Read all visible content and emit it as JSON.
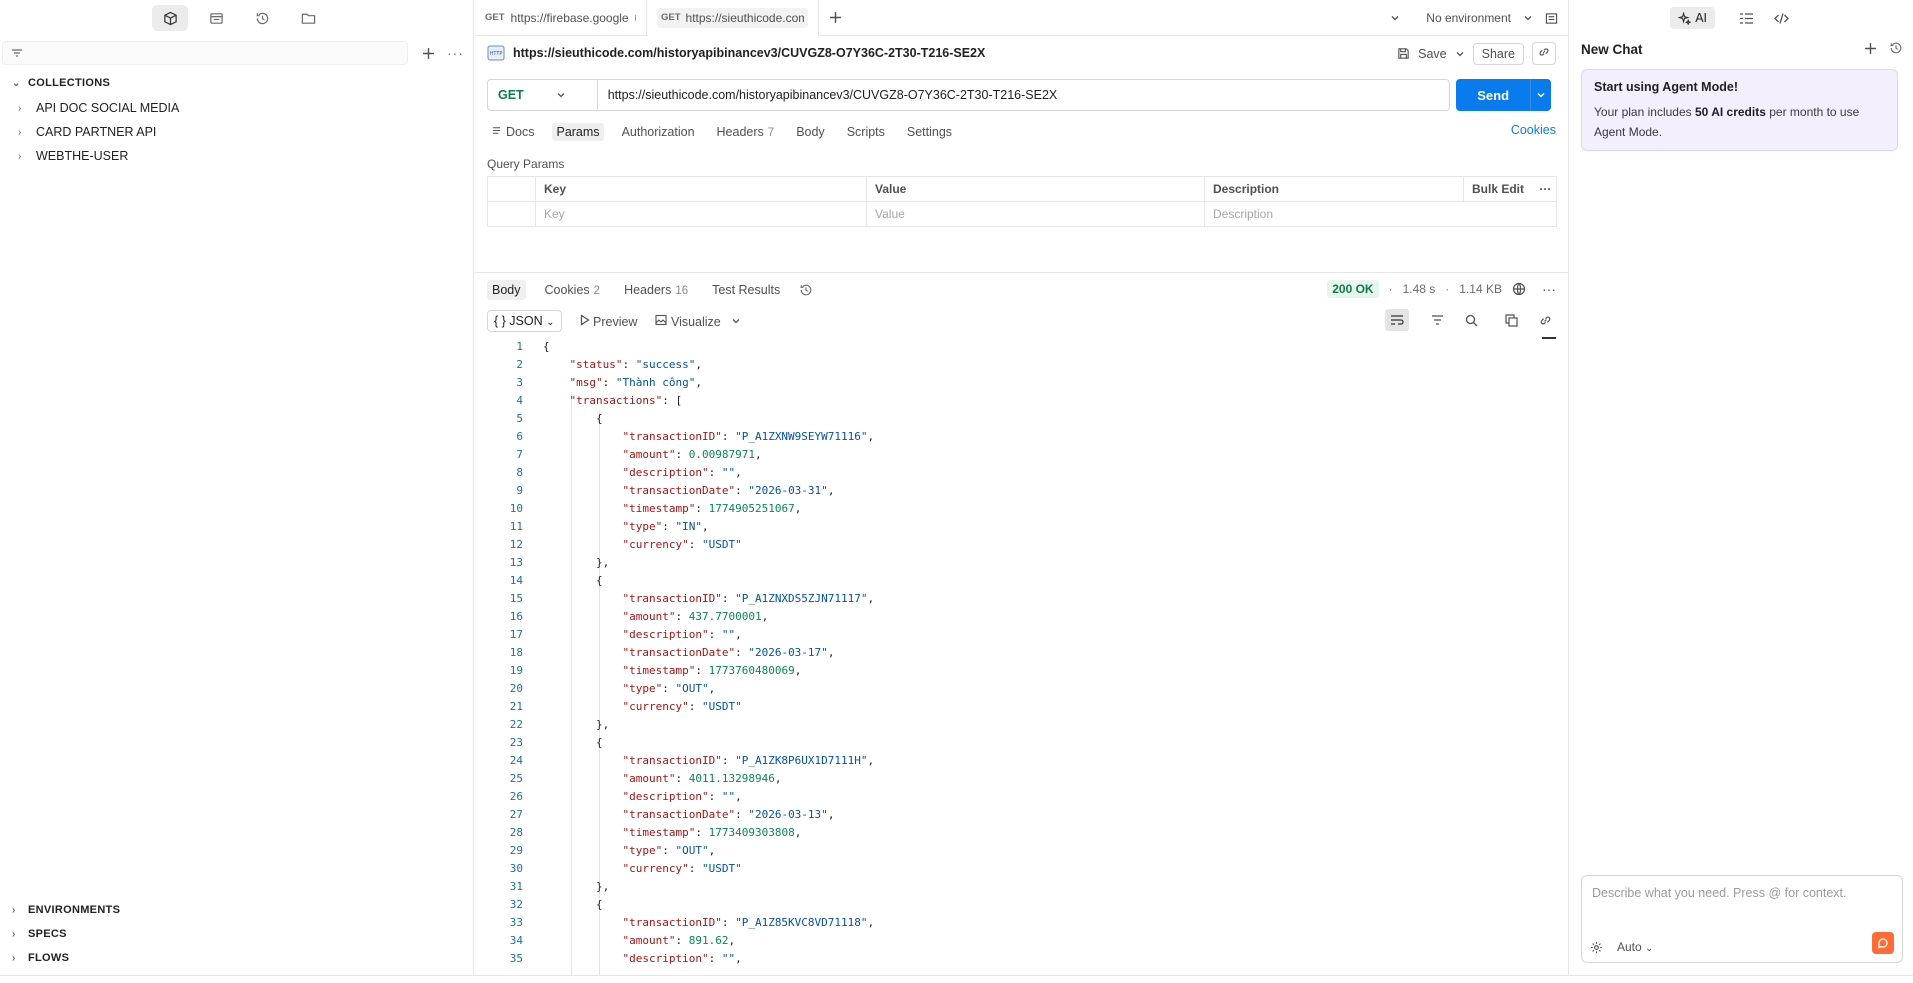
{
  "sidebar": {
    "filter_placeholder": "",
    "collections_title": "COLLECTIONS",
    "collections": [
      {
        "label": "API DOC SOCIAL MEDIA"
      },
      {
        "label": "CARD PARTNER API"
      },
      {
        "label": "WEBTHE-USER"
      }
    ],
    "environments_title": "ENVIRONMENTS",
    "specs_title": "SPECS",
    "flows_title": "FLOWS"
  },
  "tabs": [
    {
      "method": "GET",
      "label": "https://firebase.google"
    },
    {
      "method": "GET",
      "label": "https://sieuthicode.com"
    }
  ],
  "environment": {
    "selected": "No environment"
  },
  "request": {
    "title_url": "https://sieuthicode.com/historyapibinancev3/CUVGZ8-O7Y36C-2T30-T216-SE2X",
    "save_label": "Save",
    "share_label": "Share",
    "method": "GET",
    "url": "https://sieuthicode.com/historyapibinancev3/CUVGZ8-O7Y36C-2T30-T216-SE2X",
    "send_label": "Send",
    "tabs": [
      {
        "label": "Docs"
      },
      {
        "label": "Params"
      },
      {
        "label": "Authorization"
      },
      {
        "label": "Headers",
        "count": "7"
      },
      {
        "label": "Body"
      },
      {
        "label": "Scripts"
      },
      {
        "label": "Settings"
      }
    ],
    "cookies_label": "Cookies",
    "query_params_label": "Query Params",
    "params_headers": {
      "key": "Key",
      "value": "Value",
      "description": "Description",
      "bulk_edit": "Bulk Edit"
    },
    "params_placeholders": {
      "key": "Key",
      "value": "Value",
      "description": "Description"
    }
  },
  "response": {
    "tabs": [
      {
        "label": "Body"
      },
      {
        "label": "Cookies",
        "count": "2"
      },
      {
        "label": "Headers",
        "count": "16"
      },
      {
        "label": "Test Results"
      }
    ],
    "status": "200 OK",
    "time": "1.48 s",
    "size": "1.14 KB",
    "format": "JSON",
    "preview_label": "Preview",
    "visualize_label": "Visualize",
    "lines": [
      "{",
      "    \"status\": \"success\",",
      "    \"msg\": \"Thành công\",",
      "    \"transactions\": [",
      "        {",
      "            \"transactionID\": \"P_A1ZXNW9SEYW71116\",",
      "            \"amount\": 0.00987971,",
      "            \"description\": \"\",",
      "            \"transactionDate\": \"2026-03-31\",",
      "            \"timestamp\": 1774905251067,",
      "            \"type\": \"IN\",",
      "            \"currency\": \"USDT\"",
      "        },",
      "        {",
      "            \"transactionID\": \"P_A1ZNXDS5ZJN71117\",",
      "            \"amount\": 437.7700001,",
      "            \"description\": \"\",",
      "            \"transactionDate\": \"2026-03-17\",",
      "            \"timestamp\": 1773760480069,",
      "            \"type\": \"OUT\",",
      "            \"currency\": \"USDT\"",
      "        },",
      "        {",
      "            \"transactionID\": \"P_A1ZK8P6UX1D7111H\",",
      "            \"amount\": 4011.13298946,",
      "            \"description\": \"\",",
      "            \"transactionDate\": \"2026-03-13\",",
      "            \"timestamp\": 1773409303808,",
      "            \"type\": \"OUT\",",
      "            \"currency\": \"USDT\"",
      "        },",
      "        {",
      "            \"transactionID\": \"P_A1Z85KVC8VD71118\",",
      "            \"amount\": 891.62,",
      "            \"description\": \"\","
    ]
  },
  "ai_panel": {
    "ai_label": "AI",
    "chat_title": "New Chat",
    "promo_title": "Start using Agent Mode!",
    "promo_text_1": "Your plan includes ",
    "promo_bold": "50 AI credits",
    "promo_text_2": " per month to use Agent Mode.",
    "input_placeholder": "Describe what you need. Press @ for context.",
    "mode_label": "Auto"
  },
  "colors": {
    "accent": "#097bed",
    "brand": "#ff6c37",
    "get_method": "#0f7b4c"
  }
}
